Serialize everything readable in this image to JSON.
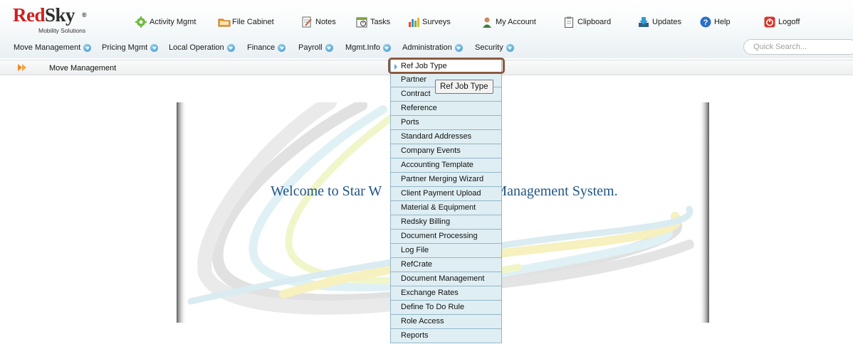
{
  "brand": {
    "part1": "Red",
    "part2": "Sky",
    "registered": "®",
    "tagline": "Mobility Solutions"
  },
  "toplinks": [
    {
      "label": "Activity Mgmt",
      "icon": "gear-icon"
    },
    {
      "label": "File Cabinet",
      "icon": "folder-icon"
    },
    {
      "label": "Notes",
      "icon": "notes-icon"
    },
    {
      "label": "Tasks",
      "icon": "tasks-icon"
    },
    {
      "label": "Surveys",
      "icon": "bar-chart-icon"
    },
    {
      "label": "My Account",
      "icon": "user-icon"
    },
    {
      "label": "Clipboard",
      "icon": "clipboard-icon"
    },
    {
      "label": "Updates",
      "icon": "download-icon"
    },
    {
      "label": "Help",
      "icon": "help-icon"
    },
    {
      "label": "Logoff",
      "icon": "power-icon"
    }
  ],
  "mainnav": [
    "Move Management",
    "Pricing Mgmt",
    "Local Operation",
    "Finance",
    "Payroll",
    "Mgmt.Info",
    "Administration",
    "Security"
  ],
  "search": {
    "placeholder": "Quick Search..."
  },
  "breadcrumb": {
    "current": "Move Management"
  },
  "welcome": {
    "text_left": "Welcome to Star W",
    "text_right": "Management System."
  },
  "dropdown": {
    "items": [
      "Ref Job Type",
      "Partner",
      "Contract",
      "Reference",
      "Ports",
      "Standard Addresses",
      "Company Events",
      "Accounting Template",
      "Partner Merging Wizard",
      "Client Payment Upload",
      "Material & Equipment",
      "Redsky Billing",
      "Document Processing",
      "Log File",
      "RefCrate",
      "Document Management",
      "Exchange Rates",
      "Define To Do Rule",
      "Role Access",
      "Reports"
    ]
  },
  "tooltip": {
    "text": "Ref Job Type"
  },
  "colors": {
    "brand_red": "#d11f1f",
    "welcome_blue": "#1f5487",
    "highlight": "#8b5a3f",
    "menu_bg": "#dfeef3"
  }
}
